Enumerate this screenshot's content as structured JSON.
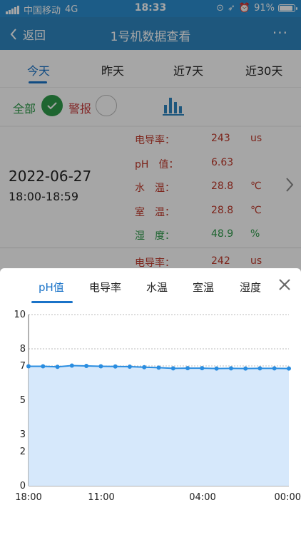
{
  "status_bar": {
    "carrier": "中国移动",
    "network": "4G",
    "time": "18:33",
    "battery": "91%"
  },
  "header": {
    "back_label": "返回",
    "title": "1号机数据查看"
  },
  "tabs": [
    {
      "label": "今天",
      "active": true
    },
    {
      "label": "昨天",
      "active": false
    },
    {
      "label": "近7天",
      "active": false
    },
    {
      "label": "近30天",
      "active": false
    }
  ],
  "filter": {
    "all_label": "全部",
    "alarm_label": "警报"
  },
  "record": {
    "date": "2022-06-27",
    "time_range": "18:00-18:59",
    "rows": [
      {
        "label": "电导率：",
        "value": "243",
        "unit": "us"
      },
      {
        "label": "pH　值：",
        "value": "6.63",
        "unit": ""
      },
      {
        "label": "水　温：",
        "value": "28.8",
        "unit": "℃"
      },
      {
        "label": "室　温：",
        "value": "28.8",
        "unit": "℃"
      },
      {
        "label": "湿　度：",
        "value": "48.9",
        "unit": "%"
      }
    ],
    "next_row": {
      "label": "电导率：",
      "value": "242",
      "unit": "us"
    }
  },
  "sheet": {
    "tabs": [
      {
        "label": "pH值",
        "active": true
      },
      {
        "label": "电导率",
        "active": false
      },
      {
        "label": "水温",
        "active": false
      },
      {
        "label": "室温",
        "active": false
      },
      {
        "label": "湿度",
        "active": false
      }
    ]
  },
  "colors": {
    "accent": "#1a73c8",
    "header": "#2e86c1",
    "alert_text": "#c0392b",
    "ok_text": "#2e9b4a",
    "line": "#2a8de0",
    "area": "#d6e8fb"
  },
  "chart_data": {
    "type": "area",
    "title": "",
    "xlabel": "",
    "ylabel": "",
    "ylim": [
      0,
      10
    ],
    "yticks": [
      0,
      2,
      3,
      5,
      7,
      8,
      10
    ],
    "xtick_labels": [
      "18:00",
      "11:00",
      "04:00",
      "00:00"
    ],
    "grid": true,
    "series": [
      {
        "values": [
          6.98,
          6.98,
          6.95,
          7.02,
          7.0,
          6.98,
          6.97,
          6.96,
          6.93,
          6.9,
          6.86,
          6.87,
          6.87,
          6.85,
          6.86,
          6.85,
          6.86,
          6.86,
          6.85
        ]
      }
    ]
  }
}
